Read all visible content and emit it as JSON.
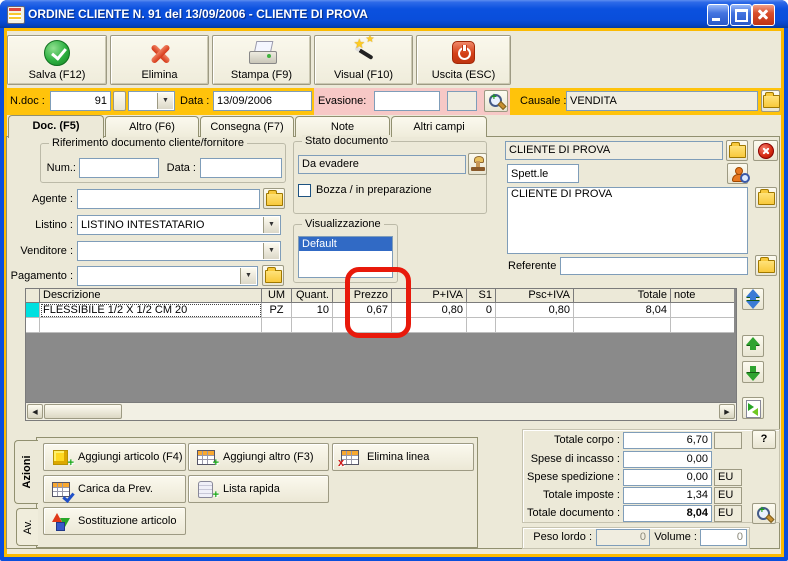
{
  "window": {
    "title": "ORDINE CLIENTE N. 91  del 13/09/2006 - CLIENTE DI PROVA"
  },
  "icons": {
    "dropdown": "▼",
    "scroll_left": "◀",
    "scroll_right": "▶",
    "star": "★",
    "plus": "+",
    "cross": "x"
  },
  "toolbar": {
    "buttons": [
      {
        "label": "Salva (F12)",
        "icon": "green-check"
      },
      {
        "label": "Elimina",
        "icon": "red-x"
      },
      {
        "label": "Stampa (F9)",
        "icon": "printer"
      },
      {
        "label": "Visual (F10)",
        "icon": "magic-wand"
      },
      {
        "label": "Uscita (ESC)",
        "icon": "power"
      }
    ]
  },
  "document_bar": {
    "ndoc_label": "N.doc :",
    "ndoc_value": "91",
    "data_label": "Data :",
    "data_value": "13/09/2006",
    "evasione_label": "Evasione:",
    "causale_label": "Causale :",
    "causale_value": "VENDITA"
  },
  "tabs": [
    {
      "label": "Doc. (F5)"
    },
    {
      "label": "Altro (F6)"
    },
    {
      "label": "Consegna (F7)"
    },
    {
      "label": "Note"
    },
    {
      "label": "Altri campi"
    }
  ],
  "riferimento": {
    "title": "Riferimento documento cliente/fornitore",
    "num_label": "Num.:",
    "data_label": "Data :"
  },
  "left_fields": {
    "agente_label": "Agente :",
    "listino_label": "Listino :",
    "listino_value": "LISTINO INTESTATARIO",
    "venditore_label": "Venditore :",
    "pagamento_label": "Pagamento :"
  },
  "stato": {
    "title": "Stato documento",
    "value": "Da evadere",
    "bozza_label": "Bozza / in preparazione"
  },
  "visualizzazione": {
    "title": "Visualizzazione",
    "selected_item": "Default"
  },
  "cliente": {
    "name": "CLIENTE DI PROVA",
    "salutation": "Spett.le",
    "address": "CLIENTE DI PROVA",
    "referente_label": "Referente"
  },
  "grid": {
    "columns": [
      "Descrizione",
      "UM",
      "Quant.",
      "Prezzo",
      "P+IVA",
      "S1",
      "Psc+IVA",
      "Totale",
      "note"
    ],
    "rows": [
      [
        "FLESSIBILE 1/2 X 1/2 CM 20",
        "PZ",
        "10",
        "0,67",
        "0,80",
        "0",
        "0,80",
        "8,04",
        ""
      ]
    ]
  },
  "annotation": {
    "color": "#E8190B"
  },
  "actions": {
    "tab_azioni": "Azioni",
    "tab_av": "Av.",
    "buttons": [
      {
        "label": "Aggiungi articolo (F4)"
      },
      {
        "label": "Aggiungi altro (F3)"
      },
      {
        "label": "Elimina linea"
      },
      {
        "label": "Carica da Prev."
      },
      {
        "label": "Lista rapida"
      },
      {
        "label": "Sostituzione articolo"
      }
    ]
  },
  "totals": {
    "help_button": "?",
    "rows": [
      {
        "label": "Totale corpo :",
        "value": "6,70",
        "unit": ""
      },
      {
        "label": "Spese di incasso :",
        "value": "0,00",
        "unit": ""
      },
      {
        "label": "Spese spedizione :",
        "value": "0,00",
        "unit": "EU"
      },
      {
        "label": "Totale imposte :",
        "value": "1,34",
        "unit": "EU"
      },
      {
        "label": "Totale documento :",
        "value": "8,04",
        "unit": "EU"
      }
    ]
  },
  "peso": {
    "peso_label": "Peso lordo :",
    "peso_value": "0",
    "volume_label": "Volume :",
    "volume_value": "0"
  }
}
